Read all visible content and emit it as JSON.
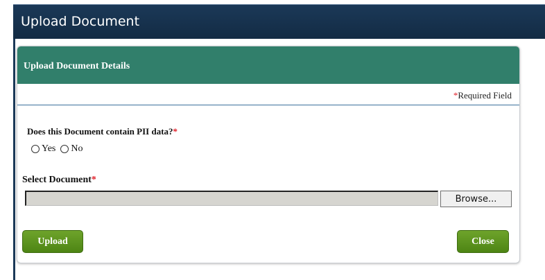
{
  "window": {
    "title": "Upload Document"
  },
  "panel": {
    "header": "Upload Document Details",
    "required_marker": "*",
    "required_text": "Required Field"
  },
  "form": {
    "pii_question": "Does this Document contain PII data?",
    "pii_required": "*",
    "pii_options": [
      "Yes",
      "No"
    ],
    "select_label": "Select Document",
    "select_required": "*",
    "file_value": "",
    "browse_label": "Browse..."
  },
  "buttons": {
    "upload": "Upload",
    "close": "Close"
  },
  "colors": {
    "titlebar": "#1b3958",
    "panel_header": "#317f6b",
    "button_green": "#5a9420",
    "required_red": "#e0202a"
  }
}
